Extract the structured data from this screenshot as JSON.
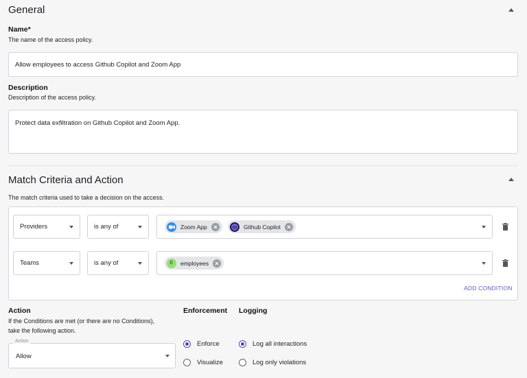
{
  "general": {
    "title": "General",
    "name_label": "Name*",
    "name_helper": "The name of the access policy.",
    "name_value": "Allow employees to access Github Copilot and Zoom App",
    "description_label": "Description",
    "description_helper": "Description of the access policy.",
    "description_value": "Protect data exfiltration on Github Copilot and Zoom App."
  },
  "criteria": {
    "title": "Match Criteria and Action",
    "helper": "The match criteria used to take a decision on the access.",
    "rows": [
      {
        "field": "Providers",
        "operator": "is any of",
        "chips": [
          "Zoom App",
          "Github Copilot"
        ]
      },
      {
        "field": "Teams",
        "operator": "is any of",
        "chips": [
          "employees"
        ]
      }
    ],
    "add_condition": "ADD CONDITION",
    "team_avatar_letter": "E"
  },
  "action": {
    "title": "Action",
    "helper_line1": "If the Conditions are met (or there are no Conditions),",
    "helper_line2": "take the following action.",
    "select_legend": "Action",
    "select_value": "Allow"
  },
  "enforcement": {
    "title": "Enforcement",
    "options": [
      "Enforce",
      "Visualize"
    ],
    "selected": "Enforce"
  },
  "logging": {
    "title": "Logging",
    "options": [
      "Log all interactions",
      "Log only violations"
    ],
    "selected": "Log all interactions"
  },
  "colors": {
    "accent": "#4b46c7",
    "link": "#5b5bd6",
    "zoom": "#2d8cff",
    "team_avatar": "#8fe36a"
  }
}
